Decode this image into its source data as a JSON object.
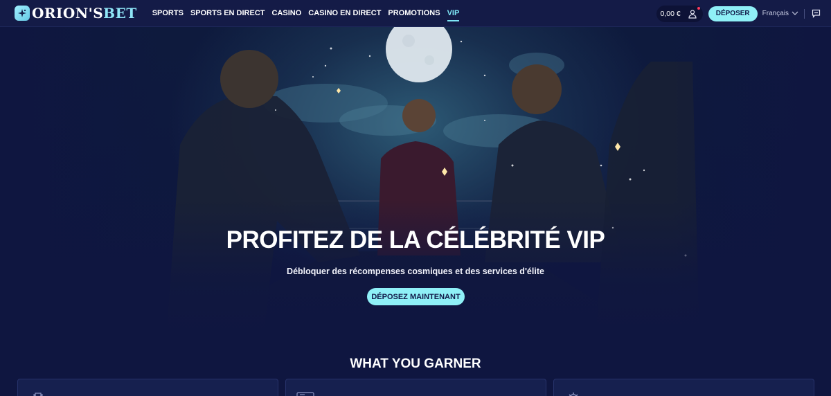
{
  "brand": {
    "name_main": "ORION'S",
    "name_accent": "BET"
  },
  "nav": {
    "items": [
      {
        "label": "SPORTS",
        "active": false
      },
      {
        "label": "SPORTS EN DIRECT",
        "active": false
      },
      {
        "label": "CASINO",
        "active": false
      },
      {
        "label": "CASINO EN DIRECT",
        "active": false
      },
      {
        "label": "PROMOTIONS",
        "active": false
      },
      {
        "label": "VIP",
        "active": true
      }
    ]
  },
  "account": {
    "balance": "0,00 €",
    "deposit_label": "DÉPOSER",
    "language": "Français",
    "icons": {
      "user": "user-icon",
      "chat": "chat-icon",
      "chevron": "chevron-down-icon"
    }
  },
  "hero": {
    "title": "PROFITEZ DE LA CÉLÉBRITÉ VIP",
    "subtitle": "Débloquer des récompenses cosmiques et des services d'élite",
    "cta_label": "DÉPOSEZ MAINTENANT"
  },
  "section": {
    "title": "WHAT YOU GARNER",
    "cards": [
      {
        "icon": "trophy-icon"
      },
      {
        "icon": "ticket-icon"
      },
      {
        "icon": "gear-icon"
      }
    ]
  },
  "colors": {
    "accent": "#8ff0f7",
    "nav_active": "#7ee6f5",
    "header_bg": "#141b47",
    "page_bg": "#0f1640",
    "notification": "#ff3b5c"
  }
}
